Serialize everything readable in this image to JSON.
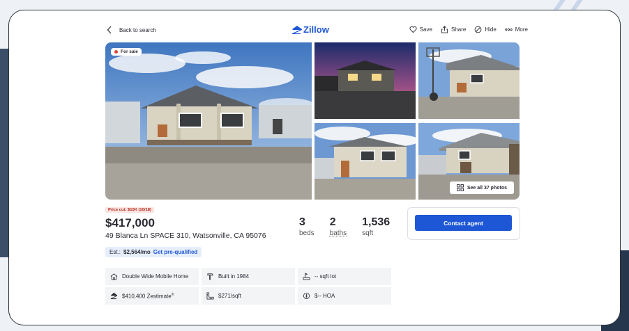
{
  "nav": {
    "back_label": "Back to search",
    "logo_text": "Zillow",
    "actions": [
      {
        "label": "Save",
        "icon": "heart-icon"
      },
      {
        "label": "Share",
        "icon": "share-icon"
      },
      {
        "label": "Hide",
        "icon": "hide-icon"
      },
      {
        "label": "More",
        "icon": "more-icon"
      }
    ]
  },
  "gallery": {
    "status_badge": "For sale",
    "see_all_label": "See all 37 photos"
  },
  "listing": {
    "price_cut": "Price cut: $10K (10/18)",
    "price": "$417,000",
    "address": "49 Blanca Ln SPACE 310, Watsonville, CA 95076",
    "beds_value": "3",
    "beds_label": "beds",
    "baths_value": "2",
    "baths_label": "baths",
    "sqft_value": "1,536",
    "sqft_label": "sqft",
    "estimate_prefix": "Est.:",
    "estimate_value": "$2,564/mo",
    "prequalify_label": "Get pre-qualified"
  },
  "facts": [
    {
      "icon": "home-type-icon",
      "text": "Double Wide Mobile Home"
    },
    {
      "icon": "hammer-icon",
      "text": "Built in 1984"
    },
    {
      "icon": "lot-icon",
      "text": "-- sqft lot"
    },
    {
      "icon": "zestimate-icon",
      "text": "$410,400 Zestimate",
      "sup": "®"
    },
    {
      "icon": "ruler-icon",
      "text": "$271/sqft"
    },
    {
      "icon": "hoa-icon",
      "text": "$-- HOA"
    }
  ],
  "contact": {
    "button_label": "Contact agent"
  },
  "colors": {
    "brand_blue": "#1e57d6",
    "price_cut_red": "#b2291c",
    "status_dot": "#e0473a"
  }
}
